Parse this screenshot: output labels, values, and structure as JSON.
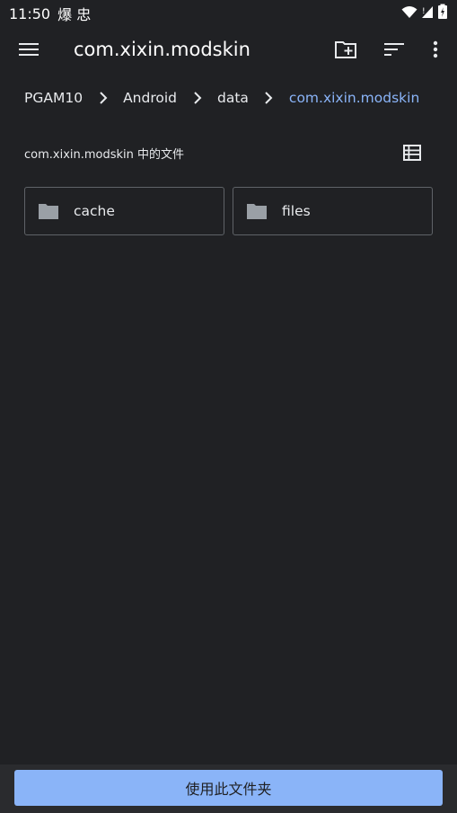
{
  "status_bar": {
    "time": "11:50",
    "notification_glyphs": "爆 忠",
    "icons": [
      "wifi-icon",
      "signal-icon",
      "battery-icon"
    ]
  },
  "app_bar": {
    "title": "com.xixin.modskin",
    "menu_icon": "menu-icon",
    "actions": [
      "new-folder-icon",
      "sort-icon",
      "more-vert-icon"
    ]
  },
  "breadcrumb": {
    "items": [
      "PGAM10",
      "Android",
      "data",
      "com.xixin.modskin"
    ]
  },
  "section": {
    "title": "com.xixin.modskin 中的文件",
    "view_icon": "list-view-icon"
  },
  "folders": [
    {
      "name": "cache",
      "icon": "folder-icon"
    },
    {
      "name": "files",
      "icon": "folder-icon"
    }
  ],
  "bottom": {
    "button_label": "使用此文件夹"
  },
  "colors": {
    "background": "#202124",
    "accent": "#8ab4f8",
    "card_border": "#5f6368",
    "text": "#e8eaed"
  }
}
